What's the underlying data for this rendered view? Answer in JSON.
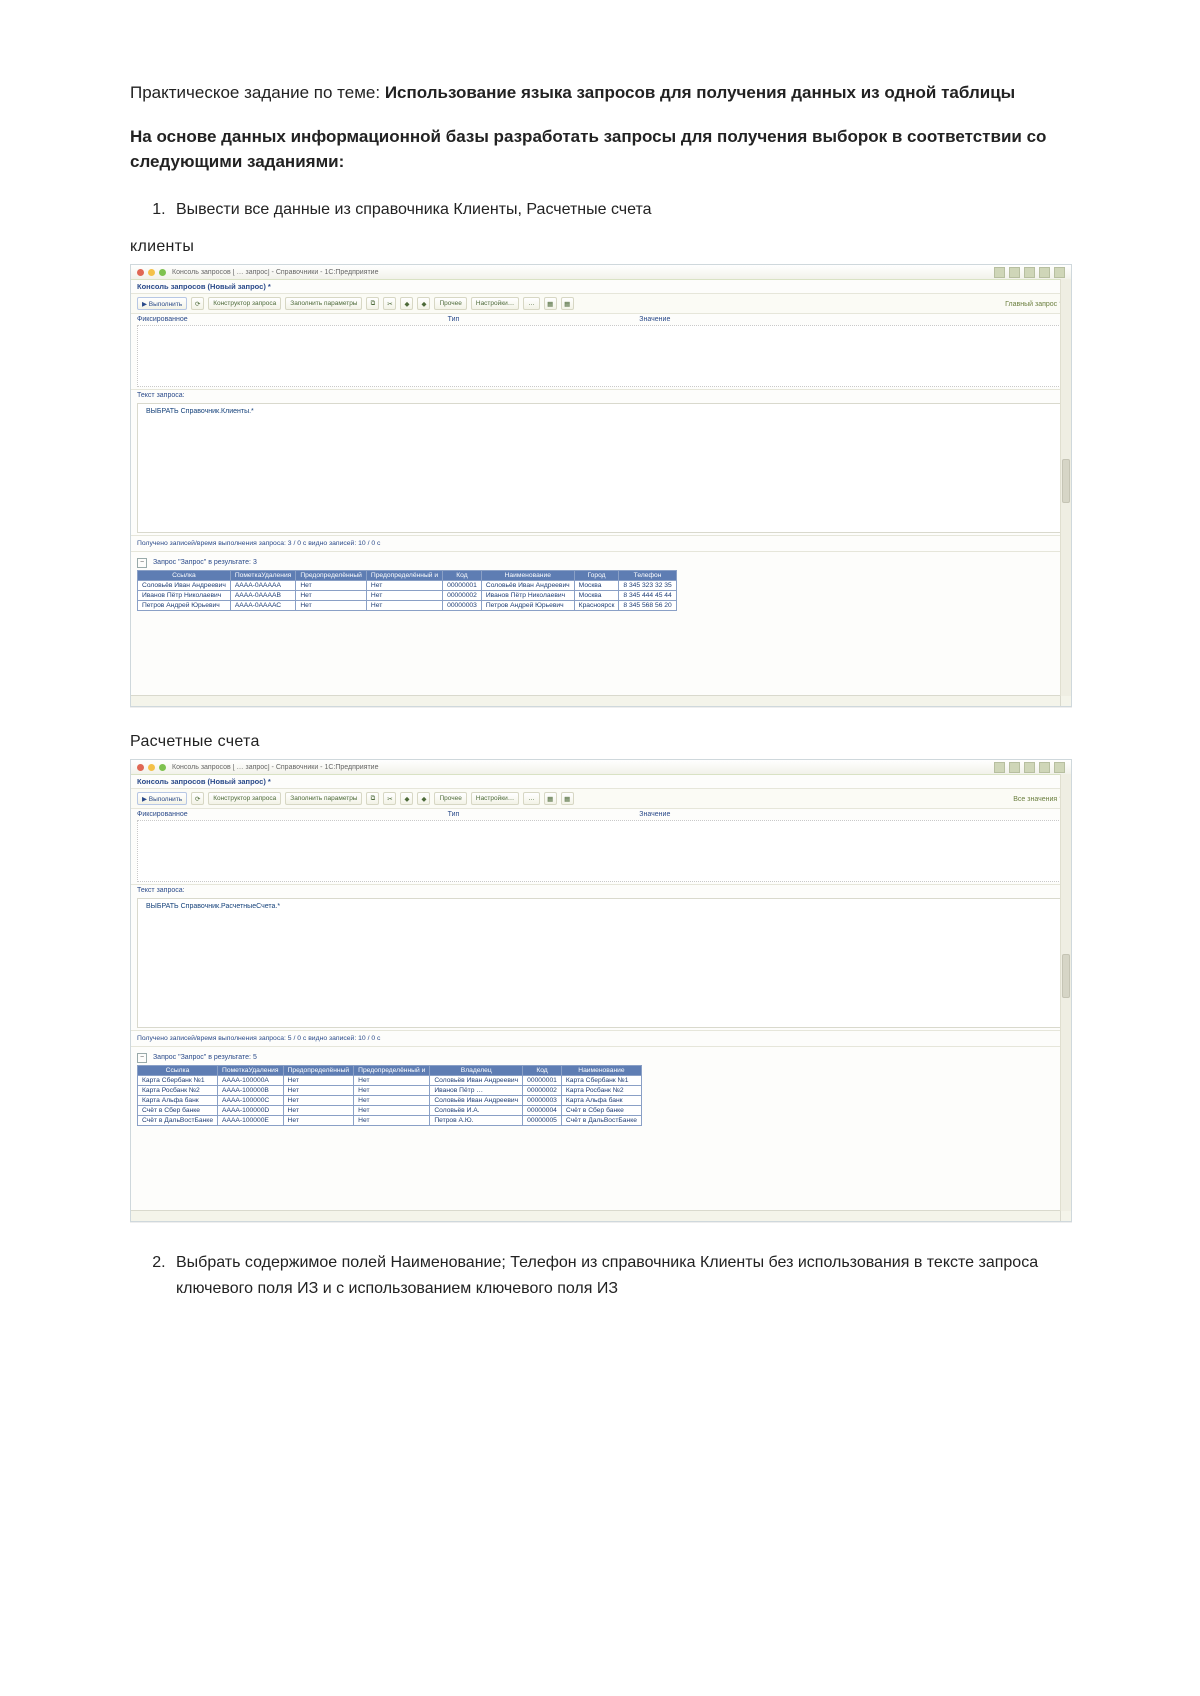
{
  "doc": {
    "task_prefix": "Практическое задание по теме: ",
    "title_bold": "Использование языка запросов для получения данных из одной таблицы",
    "subtask": "На основе данных информационной базы разработать запросы для получения выборок в соответствии со следующими заданиями:",
    "item1": "Вывести все данные из справочника Клиенты, Расчетные счета",
    "label_clients": "клиенты",
    "label_accounts": "Расчетные счета",
    "item2": "Выбрать содержимое полей Наименование; Телефон из справочника Клиенты без использования в тексте запроса ключевого поля ИЗ и с использованием ключевого поля ИЗ"
  },
  "win_common": {
    "app_title": "Консоль запросов [ … запрос] - Справочники - 1С:Предприятие",
    "tab_title": "Консоль запросов (Новый запрос) *",
    "btn_execute": "▶ Выполнить",
    "btn_builder": "Конструктор запроса",
    "btn_paramset": "Заполнить параметры",
    "btn_tools": "Прочее",
    "btn_settings": "Настройки…",
    "btn_more": "…",
    "hdr_params_file": "Фиксированное",
    "hdr_params_type": "Тип",
    "hdr_params_val": "Значение",
    "query_section": "Текст запроса:"
  },
  "win1": {
    "right_label": "Главный запрос ✎",
    "query_text": "ВЫБРАТЬ Справочник.Клиенты.*",
    "stats": "Получено записей/время выполнения запроса: 3 / 0 с   видно записей: 10 / 0 с",
    "result_caption": "Запрос \"Запрос\" в результате: 3",
    "cols": [
      "Ссылка",
      "ПометкаУдаления",
      "Предопределённый",
      "Предопределённый и",
      "Код",
      "Наименование",
      "Город",
      "Телефон"
    ],
    "rows": [
      [
        "Соловьёв Иван Андреевич",
        "АААА-0ААААА",
        "Нет",
        "Нет",
        "00000001",
        "Соловьёв Иван Андреевич",
        "Москва",
        "8 345 323 32 35"
      ],
      [
        "Иванов Пётр Николаевич",
        "АААА-0ААААВ",
        "Нет",
        "Нет",
        "00000002",
        "Иванов Пётр Николаевич",
        "Москва",
        "8 345 444 45 44"
      ],
      [
        "Петров Андрей Юрьевич",
        "АААА-0ААААС",
        "Нет",
        "Нет",
        "00000003",
        "Петров Андрей Юрьевич",
        "Красноярск",
        "8 345 568 56 20"
      ]
    ]
  },
  "win2": {
    "right_label": "Все значения ✎",
    "query_label_alt": "Текст запроса:",
    "query_text": "ВЫБРАТЬ Справочник.РасчетныеСчета.*",
    "stats": "Получено записей/время выполнения запроса: 5 / 0 с   видно записей: 10 / 0 с",
    "result_caption": "Запрос \"Запрос\" в результате: 5",
    "cols": [
      "Ссылка",
      "ПометкаУдаления",
      "Предопределённый",
      "Предопределённый и",
      "Владелец",
      "Код",
      "Наименование"
    ],
    "rows": [
      [
        "Карта Сбербанк №1",
        "АААА-100000А",
        "Нет",
        "Нет",
        "Соловьёв Иван Андреевич",
        "00000001",
        "Карта Сбербанк №1"
      ],
      [
        "Карта Росбанк №2",
        "АААА-100000В",
        "Нет",
        "Нет",
        "Иванов Пётр …",
        "00000002",
        "Карта Росбанк №2"
      ],
      [
        "Карта Альфа банк",
        "АААА-100000С",
        "Нет",
        "Нет",
        "Соловьёв Иван Андреевич",
        "00000003",
        "Карта Альфа банк"
      ],
      [
        "Счёт в Сбер банке",
        "АААА-100000D",
        "Нет",
        "Нет",
        "Соловьёв И.А.",
        "00000004",
        "Счёт в Сбер банке"
      ],
      [
        "Счёт в ДальВостБанке",
        "АААА-100000Е",
        "Нет",
        "Нет",
        "Петров А.Ю.",
        "00000005",
        "Счёт в ДальВостБанке"
      ]
    ]
  }
}
